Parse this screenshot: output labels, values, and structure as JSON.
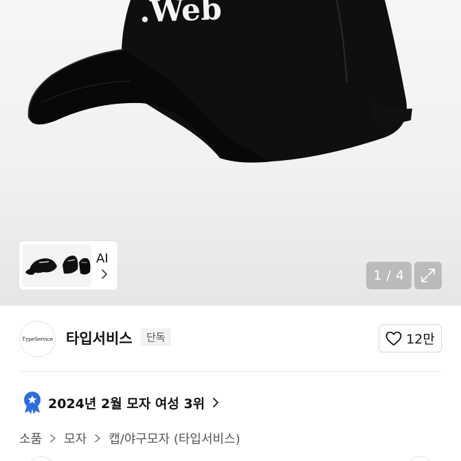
{
  "product_image": {
    "cap_text": ".Web",
    "counter": "1 / 4",
    "ai_card": {
      "label": "AI"
    }
  },
  "seller": {
    "logo_text": "TypeService",
    "name": "타입서비스",
    "badge": "단독"
  },
  "like": {
    "count": "12만"
  },
  "ranking": {
    "text": "2024년 2월 모자 여성 3위"
  },
  "breadcrumb": {
    "items": [
      "소품",
      "모자",
      "캡/야구모자 (타입서비스)"
    ]
  },
  "colors": {
    "cap": "#0d0d0d",
    "rank_badge": "#2d6cdf",
    "counter_bg": "#969696"
  }
}
